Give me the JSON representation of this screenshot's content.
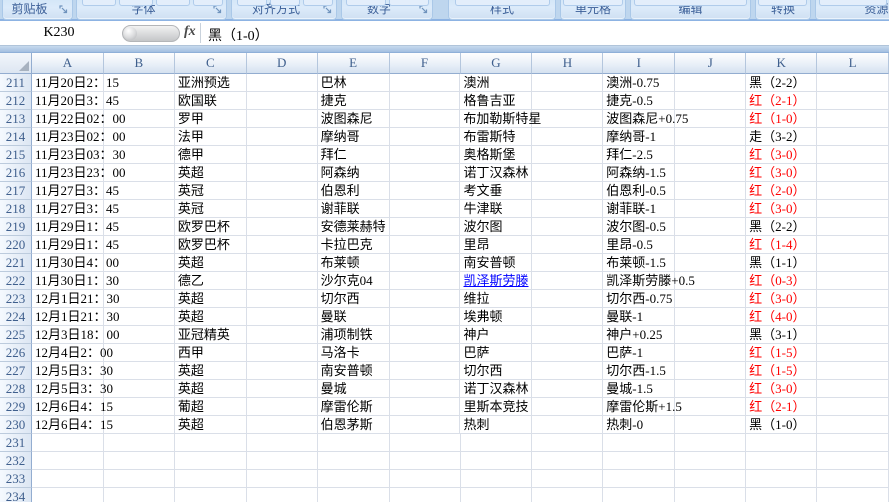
{
  "ribbon": {
    "groups": [
      {
        "label": "剪贴板"
      },
      {
        "label": "字体"
      },
      {
        "label": "对齐方式"
      },
      {
        "label": "数字"
      },
      {
        "label": "样式"
      },
      {
        "label": "单元格"
      },
      {
        "label": "编辑"
      },
      {
        "label": "转换"
      },
      {
        "label": "资源中"
      }
    ]
  },
  "formula_bar": {
    "name_box": "K230",
    "fx_label": "fx",
    "formula": "黑（1-0）"
  },
  "colors": {
    "result_red": "#ff0000",
    "result_black": "#000000",
    "link_blue": "#0000ff"
  },
  "grid": {
    "column_headers": [
      "A",
      "B",
      "C",
      "D",
      "E",
      "F",
      "G",
      "H",
      "I",
      "J",
      "K",
      "L"
    ],
    "rows": [
      {
        "num": 211,
        "cells": {
          "A": "11月20日2：15",
          "C": "亚洲预选",
          "E": "巴林",
          "G": "澳洲",
          "I": "澳洲-0.75",
          "K": "黑（2-2）"
        },
        "k_color": "black"
      },
      {
        "num": 212,
        "cells": {
          "A": "11月20日3：45",
          "C": "欧国联",
          "E": "捷克",
          "G": "格鲁吉亚",
          "I": "捷克-0.5",
          "K": "红（2-1）"
        },
        "k_color": "red"
      },
      {
        "num": 213,
        "cells": {
          "A": "11月22日02：00",
          "C": "罗甲",
          "E": "波图森尼",
          "G": "布加勒斯特星",
          "I": "波图森尼+0.75",
          "K": "红（1-0）"
        },
        "k_color": "red"
      },
      {
        "num": 214,
        "cells": {
          "A": "11月23日02：00",
          "C": "法甲",
          "E": "摩纳哥",
          "G": "布雷斯特",
          "I": "摩纳哥-1",
          "K": "走（3-2）"
        },
        "k_color": "black"
      },
      {
        "num": 215,
        "cells": {
          "A": "11月23日03：30",
          "C": "德甲",
          "E": "拜仁",
          "G": "奥格斯堡",
          "I": "拜仁-2.5",
          "K": "红（3-0）"
        },
        "k_color": "red"
      },
      {
        "num": 216,
        "cells": {
          "A": "11月23日23：00",
          "C": "英超",
          "E": "阿森纳",
          "G": "诺丁汉森林",
          "I": "阿森纳-1.5",
          "K": "红（3-0）"
        },
        "k_color": "red"
      },
      {
        "num": 217,
        "cells": {
          "A": "11月27日3：45",
          "C": "英冠",
          "E": "伯恩利",
          "G": "考文垂",
          "I": "伯恩利-0.5",
          "K": "红（2-0）"
        },
        "k_color": "red"
      },
      {
        "num": 218,
        "cells": {
          "A": "11月27日3：45",
          "C": "英冠",
          "E": "谢菲联",
          "G": "牛津联",
          "I": "谢菲联-1",
          "K": "红（3-0）"
        },
        "k_color": "red"
      },
      {
        "num": 219,
        "cells": {
          "A": "11月29日1：45",
          "C": "欧罗巴杯",
          "E": "安德莱赫特",
          "G": "波尔图",
          "I": "波尔图-0.5",
          "K": "黑（2-2）"
        },
        "k_color": "black"
      },
      {
        "num": 220,
        "cells": {
          "A": "11月29日1：45",
          "C": "欧罗巴杯",
          "E": "卡拉巴克",
          "G": "里昂",
          "I": "里昂-0.5",
          "K": "红（1-4）"
        },
        "k_color": "red"
      },
      {
        "num": 221,
        "cells": {
          "A": "11月30日4：00",
          "C": "英超",
          "E": "布莱顿",
          "G": "南安普顿",
          "I": "布莱顿-1.5",
          "K": "黑（1-1）"
        },
        "k_color": "black"
      },
      {
        "num": 222,
        "cells": {
          "A": "11月30日1：30",
          "C": "德乙",
          "E": "沙尔克04",
          "G": "凯泽斯劳滕",
          "I": "凯泽斯劳滕+0.5",
          "K": "红（0-3）"
        },
        "k_color": "red",
        "link_col": "G"
      },
      {
        "num": 223,
        "cells": {
          "A": "12月1日21：30",
          "C": "英超",
          "E": "切尔西",
          "G": "维拉",
          "I": "切尔西-0.75",
          "K": "红（3-0）"
        },
        "k_color": "red"
      },
      {
        "num": 224,
        "cells": {
          "A": "12月1日21：30",
          "C": "英超",
          "E": "曼联",
          "G": "埃弗顿",
          "I": "曼联-1",
          "K": "红（4-0）"
        },
        "k_color": "red"
      },
      {
        "num": 225,
        "cells": {
          "A": "12月3日18：00",
          "C": "亚冠精英",
          "E": "浦项制铁",
          "G": "神户",
          "I": "神户+0.25",
          "K": "黑（3-1）"
        },
        "k_color": "black"
      },
      {
        "num": 226,
        "cells": {
          "A": "12月4日2：00",
          "C": "西甲",
          "E": "马洛卡",
          "G": "巴萨",
          "I": "巴萨-1",
          "K": "红（1-5）"
        },
        "k_color": "red"
      },
      {
        "num": 227,
        "cells": {
          "A": "12月5日3：30",
          "C": "英超",
          "E": "南安普顿",
          "G": "切尔西",
          "I": "切尔西-1.5",
          "K": "红（1-5）"
        },
        "k_color": "red"
      },
      {
        "num": 228,
        "cells": {
          "A": "12月5日3：30",
          "C": "英超",
          "E": "曼城",
          "G": "诺丁汉森林",
          "I": "曼城-1.5",
          "K": "红（3-0）"
        },
        "k_color": "red"
      },
      {
        "num": 229,
        "cells": {
          "A": "12月6日4：15",
          "C": "葡超",
          "E": "摩雷伦斯",
          "G": "里斯本竞技",
          "I": "摩雷伦斯+1.5",
          "K": "红（2-1）"
        },
        "k_color": "red"
      },
      {
        "num": 230,
        "cells": {
          "A": "12月6日4：15",
          "C": "英超",
          "E": "伯恩茅斯",
          "G": "热刺",
          "I": "热刺-0",
          "K": "黑（1-0）"
        },
        "k_color": "black"
      },
      {
        "num": 231
      },
      {
        "num": 232
      },
      {
        "num": 233
      },
      {
        "num": 234
      }
    ]
  }
}
